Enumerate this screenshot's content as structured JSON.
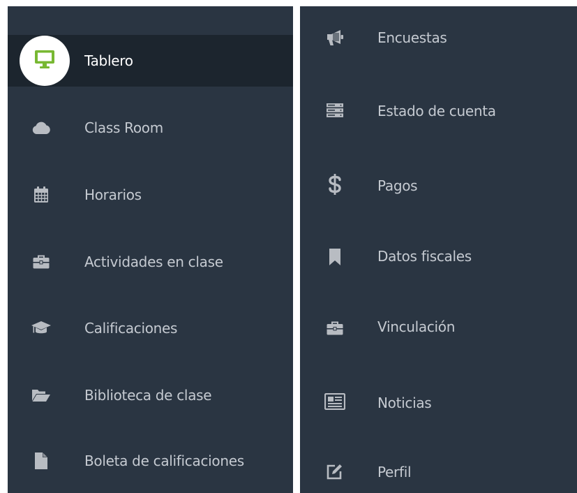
{
  "left_menu": {
    "items": [
      {
        "label": "Tablero",
        "icon": "monitor-icon",
        "active": true
      },
      {
        "label": "Class Room",
        "icon": "cloud-icon"
      },
      {
        "label": "Horarios",
        "icon": "calendar-icon"
      },
      {
        "label": "Actividades en clase",
        "icon": "briefcase-icon"
      },
      {
        "label": "Calificaciones",
        "icon": "graduation-cap-icon"
      },
      {
        "label": "Biblioteca de clase",
        "icon": "folder-open-icon"
      },
      {
        "label": "Boleta de calificaciones",
        "icon": "file-icon"
      }
    ]
  },
  "right_menu": {
    "items": [
      {
        "label": "Encuestas",
        "icon": "bullhorn-icon"
      },
      {
        "label": "Estado de cuenta",
        "icon": "server-icon"
      },
      {
        "label": "Pagos",
        "icon": "dollar-icon"
      },
      {
        "label": "Datos fiscales",
        "icon": "bookmark-icon"
      },
      {
        "label": "Vinculación",
        "icon": "briefcase-icon"
      },
      {
        "label": "Noticias",
        "icon": "newspaper-icon"
      },
      {
        "label": "Perfil",
        "icon": "edit-icon"
      }
    ]
  },
  "colors": {
    "sidebar_bg": "#2a3542",
    "active_bg": "#1c252e",
    "text": "#c5cad1",
    "active_text": "#ffffff",
    "icon": "#b8bcc2",
    "active_icon": "#78b832"
  }
}
